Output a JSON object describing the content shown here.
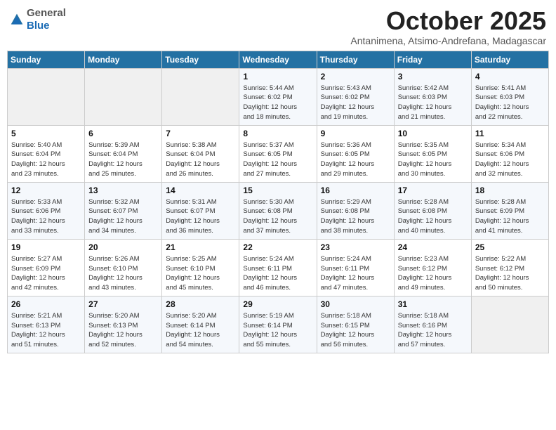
{
  "header": {
    "logo_general": "General",
    "logo_blue": "Blue",
    "month_title": "October 2025",
    "subtitle": "Antanimena, Atsimo-Andrefana, Madagascar"
  },
  "weekdays": [
    "Sunday",
    "Monday",
    "Tuesday",
    "Wednesday",
    "Thursday",
    "Friday",
    "Saturday"
  ],
  "weeks": [
    [
      {
        "day": "",
        "info": ""
      },
      {
        "day": "",
        "info": ""
      },
      {
        "day": "",
        "info": ""
      },
      {
        "day": "1",
        "info": "Sunrise: 5:44 AM\nSunset: 6:02 PM\nDaylight: 12 hours\nand 18 minutes."
      },
      {
        "day": "2",
        "info": "Sunrise: 5:43 AM\nSunset: 6:02 PM\nDaylight: 12 hours\nand 19 minutes."
      },
      {
        "day": "3",
        "info": "Sunrise: 5:42 AM\nSunset: 6:03 PM\nDaylight: 12 hours\nand 21 minutes."
      },
      {
        "day": "4",
        "info": "Sunrise: 5:41 AM\nSunset: 6:03 PM\nDaylight: 12 hours\nand 22 minutes."
      }
    ],
    [
      {
        "day": "5",
        "info": "Sunrise: 5:40 AM\nSunset: 6:04 PM\nDaylight: 12 hours\nand 23 minutes."
      },
      {
        "day": "6",
        "info": "Sunrise: 5:39 AM\nSunset: 6:04 PM\nDaylight: 12 hours\nand 25 minutes."
      },
      {
        "day": "7",
        "info": "Sunrise: 5:38 AM\nSunset: 6:04 PM\nDaylight: 12 hours\nand 26 minutes."
      },
      {
        "day": "8",
        "info": "Sunrise: 5:37 AM\nSunset: 6:05 PM\nDaylight: 12 hours\nand 27 minutes."
      },
      {
        "day": "9",
        "info": "Sunrise: 5:36 AM\nSunset: 6:05 PM\nDaylight: 12 hours\nand 29 minutes."
      },
      {
        "day": "10",
        "info": "Sunrise: 5:35 AM\nSunset: 6:05 PM\nDaylight: 12 hours\nand 30 minutes."
      },
      {
        "day": "11",
        "info": "Sunrise: 5:34 AM\nSunset: 6:06 PM\nDaylight: 12 hours\nand 32 minutes."
      }
    ],
    [
      {
        "day": "12",
        "info": "Sunrise: 5:33 AM\nSunset: 6:06 PM\nDaylight: 12 hours\nand 33 minutes."
      },
      {
        "day": "13",
        "info": "Sunrise: 5:32 AM\nSunset: 6:07 PM\nDaylight: 12 hours\nand 34 minutes."
      },
      {
        "day": "14",
        "info": "Sunrise: 5:31 AM\nSunset: 6:07 PM\nDaylight: 12 hours\nand 36 minutes."
      },
      {
        "day": "15",
        "info": "Sunrise: 5:30 AM\nSunset: 6:08 PM\nDaylight: 12 hours\nand 37 minutes."
      },
      {
        "day": "16",
        "info": "Sunrise: 5:29 AM\nSunset: 6:08 PM\nDaylight: 12 hours\nand 38 minutes."
      },
      {
        "day": "17",
        "info": "Sunrise: 5:28 AM\nSunset: 6:08 PM\nDaylight: 12 hours\nand 40 minutes."
      },
      {
        "day": "18",
        "info": "Sunrise: 5:28 AM\nSunset: 6:09 PM\nDaylight: 12 hours\nand 41 minutes."
      }
    ],
    [
      {
        "day": "19",
        "info": "Sunrise: 5:27 AM\nSunset: 6:09 PM\nDaylight: 12 hours\nand 42 minutes."
      },
      {
        "day": "20",
        "info": "Sunrise: 5:26 AM\nSunset: 6:10 PM\nDaylight: 12 hours\nand 43 minutes."
      },
      {
        "day": "21",
        "info": "Sunrise: 5:25 AM\nSunset: 6:10 PM\nDaylight: 12 hours\nand 45 minutes."
      },
      {
        "day": "22",
        "info": "Sunrise: 5:24 AM\nSunset: 6:11 PM\nDaylight: 12 hours\nand 46 minutes."
      },
      {
        "day": "23",
        "info": "Sunrise: 5:24 AM\nSunset: 6:11 PM\nDaylight: 12 hours\nand 47 minutes."
      },
      {
        "day": "24",
        "info": "Sunrise: 5:23 AM\nSunset: 6:12 PM\nDaylight: 12 hours\nand 49 minutes."
      },
      {
        "day": "25",
        "info": "Sunrise: 5:22 AM\nSunset: 6:12 PM\nDaylight: 12 hours\nand 50 minutes."
      }
    ],
    [
      {
        "day": "26",
        "info": "Sunrise: 5:21 AM\nSunset: 6:13 PM\nDaylight: 12 hours\nand 51 minutes."
      },
      {
        "day": "27",
        "info": "Sunrise: 5:20 AM\nSunset: 6:13 PM\nDaylight: 12 hours\nand 52 minutes."
      },
      {
        "day": "28",
        "info": "Sunrise: 5:20 AM\nSunset: 6:14 PM\nDaylight: 12 hours\nand 54 minutes."
      },
      {
        "day": "29",
        "info": "Sunrise: 5:19 AM\nSunset: 6:14 PM\nDaylight: 12 hours\nand 55 minutes."
      },
      {
        "day": "30",
        "info": "Sunrise: 5:18 AM\nSunset: 6:15 PM\nDaylight: 12 hours\nand 56 minutes."
      },
      {
        "day": "31",
        "info": "Sunrise: 5:18 AM\nSunset: 6:16 PM\nDaylight: 12 hours\nand 57 minutes."
      },
      {
        "day": "",
        "info": ""
      }
    ]
  ]
}
